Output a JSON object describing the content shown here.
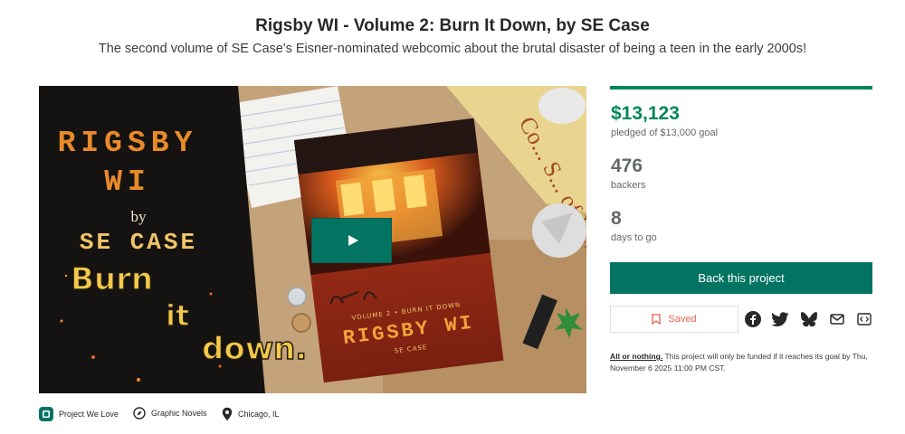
{
  "project": {
    "title": "Rigsby WI - Volume 2: Burn It Down, by SE Case",
    "blurb": "The second volume of SE Case's Eisner-nominated webcomic about the brutal disaster of being a teen in the early 2000s!"
  },
  "media": {
    "cover_words": [
      "RIGSBY",
      "WI",
      "by",
      "SE CASE",
      "Burn",
      "it",
      "down."
    ],
    "book_words": [
      "VOLUME 2 • BURN IT DOWN",
      "RIGSBY WI",
      "SE CASE"
    ],
    "book_spine_text": "Co... S... of E... Hem...",
    "play_icon": "play-icon"
  },
  "stats": {
    "pledged": "$13,123",
    "pledged_label": "pledged of $13,000 goal",
    "funded_fraction": 1.0,
    "backers": "476",
    "backers_label": "backers",
    "days": "8",
    "days_label": "days to go"
  },
  "actions": {
    "back_label": "Back this project",
    "saved_label": "Saved",
    "share_icons": [
      "facebook-icon",
      "twitter-icon",
      "bluesky-icon",
      "email-icon",
      "embed-icon"
    ]
  },
  "funding": {
    "strong": "All or nothing.",
    "text": " This project will only be funded if it reaches its goal by Thu, November 6 2025 11:00 PM CST."
  },
  "tags": [
    {
      "icon": "kickstarter-k-icon",
      "label": "Project We Love"
    },
    {
      "icon": "compass-icon",
      "label": "Graphic Novels"
    },
    {
      "icon": "location-pin-icon",
      "label": "Chicago, IL"
    }
  ],
  "colors": {
    "brand_green": "#037362",
    "funded_green": "#028858",
    "saved_red": "#e8614e"
  }
}
